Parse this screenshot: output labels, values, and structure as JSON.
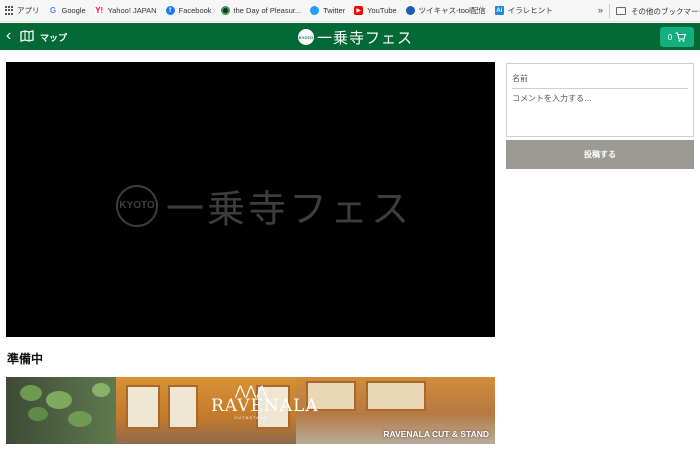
{
  "bookmarks_bar": {
    "items": [
      {
        "label": "アプリ",
        "icon": "apps-grid-icon"
      },
      {
        "label": "Google",
        "icon": "google-icon"
      },
      {
        "label": "Yahoo! JAPAN",
        "icon": "yahoo-japan-icon"
      },
      {
        "label": "Facebook",
        "icon": "facebook-icon"
      },
      {
        "label": "the Day of Pleasur...",
        "icon": "day-of-pleasure-icon"
      },
      {
        "label": "Twitter",
        "icon": "twitter-icon"
      },
      {
        "label": "YouTube",
        "icon": "youtube-icon"
      },
      {
        "label": "ツイキャス-tool配信",
        "icon": "twitcasting-icon"
      },
      {
        "label": "イラレヒント",
        "icon": "irare-hint-icon"
      }
    ],
    "overflow": "»",
    "other_bookmarks": "その他のブックマーク"
  },
  "header": {
    "map_label": "マップ",
    "logo_badge": "KYOTO",
    "logo_text": "一乗寺フェス",
    "cart_count": "0",
    "brand_color": "#036a36"
  },
  "video": {
    "watermark_badge": "KYOTO",
    "watermark_text": "一乗寺フェス"
  },
  "status_text": "準備中",
  "banner": {
    "brand_name": "RAVENALA",
    "brand_sub": "CUT&STAND",
    "caption": "RAVENALA CUT & STAND"
  },
  "comment_form": {
    "name_placeholder": "名前",
    "comment_placeholder": "コメントを入力する…",
    "submit_label": "投稿する"
  }
}
